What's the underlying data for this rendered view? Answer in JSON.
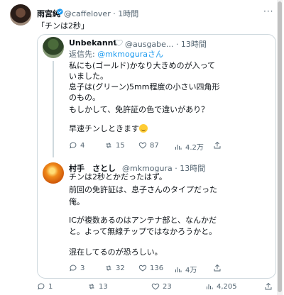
{
  "tweet": {
    "author_name": "雨宮純",
    "handle": "@caffelover",
    "time": "1時間",
    "text": "「チンは2秒」",
    "stats": {
      "replies": "1",
      "retweets": "13",
      "likes": "23",
      "views": "4,205"
    }
  },
  "quote": {
    "reply1": {
      "author_name": "Unbekannt",
      "meta": "@ausgabe... · 13時間",
      "reply_to_prefix": "返信先: ",
      "reply_to_handle": "@mkmoguraさん",
      "lines": [
        "私にも(ゴールド)かなり大きめのが入って",
        "いました。",
        "息子は(グリーン)5mm程度の小さい四角形",
        "のもの。",
        "もしかして、免許証の色で違いがあり？"
      ],
      "line_last": "早速チンしときます",
      "emoji": "grinning-sweat-emoji",
      "stats": {
        "replies": "4",
        "retweets": "15",
        "likes": "87",
        "views": "4.2万"
      }
    },
    "reply2": {
      "author_name": "村手　さとし",
      "meta": "@mkmogura · 13時間",
      "lines": [
        "チンは2秒とかだったはず。",
        "前回の免許証は、息子さんのタイプだった",
        "俺。",
        "",
        "ICが複数あるのはアンテナ部と、なんかだ",
        "と。よって無線チップではなかろうかと。",
        "",
        "混在してるのが恐ろしい。"
      ],
      "stats": {
        "replies": "3",
        "retweets": "32",
        "likes": "136",
        "views": "4万"
      }
    }
  },
  "colors": {
    "accent": "#1d9bf0",
    "verified": "#1d9bf0",
    "muted": "#536471",
    "border": "#cfd9de"
  }
}
